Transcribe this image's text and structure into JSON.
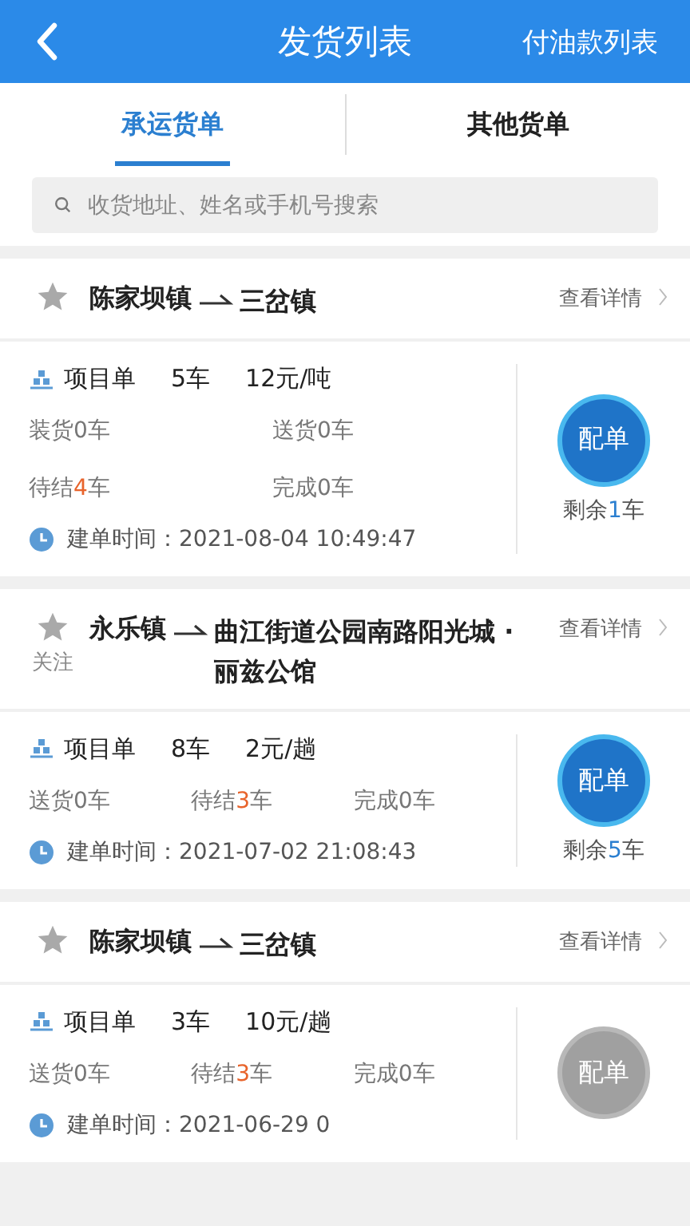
{
  "header": {
    "title": "发货列表",
    "action": "付油款列表"
  },
  "tabs": [
    {
      "label": "承运货单",
      "selected": true
    },
    {
      "label": "其他货单",
      "selected": false
    }
  ],
  "search": {
    "placeholder": "收货地址、姓名或手机号搜索"
  },
  "orders": [
    {
      "starred": false,
      "from": "陈家坝镇",
      "to": "三岔镇",
      "detail": "查看详情",
      "project": "项目单",
      "cars": "5车",
      "price": "12元/吨",
      "stats": [
        {
          "label": "装货",
          "count": "0",
          "unit": "车",
          "highlight": false
        },
        {
          "label": "送货",
          "count": "0",
          "unit": "车",
          "highlight": false
        },
        {
          "label": "待结",
          "count": "4",
          "unit": "车",
          "highlight": true
        },
        {
          "label": "完成",
          "count": "0",
          "unit": "车",
          "highlight": false
        }
      ],
      "time_label": "建单时间：",
      "time": "2021-08-04 10:49:47",
      "button": {
        "label": "配单",
        "disabled": false
      },
      "remaining": {
        "prefix": "剩余",
        "count": "1",
        "unit": "车"
      }
    },
    {
      "starred": false,
      "follow": "关注",
      "from": "永乐镇",
      "to": "曲江街道公园南路阳光城 · 丽兹公馆",
      "detail": "查看详情",
      "project": "项目单",
      "cars": "8车",
      "price": "2元/趟",
      "stats": [
        {
          "label": "送货",
          "count": "0",
          "unit": "车",
          "highlight": false
        },
        {
          "label": "待结",
          "count": "3",
          "unit": "车",
          "highlight": true
        },
        {
          "label": "完成",
          "count": "0",
          "unit": "车",
          "highlight": false
        }
      ],
      "time_label": "建单时间：",
      "time": "2021-07-02 21:08:43",
      "button": {
        "label": "配单",
        "disabled": false
      },
      "remaining": {
        "prefix": "剩余",
        "count": "5",
        "unit": "车"
      }
    },
    {
      "starred": false,
      "from": "陈家坝镇",
      "to": "三岔镇",
      "detail": "查看详情",
      "project": "项目单",
      "cars": "3车",
      "price": "10元/趟",
      "stats": [
        {
          "label": "送货",
          "count": "0",
          "unit": "车",
          "highlight": false
        },
        {
          "label": "待结",
          "count": "3",
          "unit": "车",
          "highlight": true
        },
        {
          "label": "完成",
          "count": "0",
          "unit": "车",
          "highlight": false
        }
      ],
      "time_label": "建单时间：",
      "time": "2021-06-29 0",
      "button": {
        "label": "配单",
        "disabled": true
      }
    }
  ]
}
